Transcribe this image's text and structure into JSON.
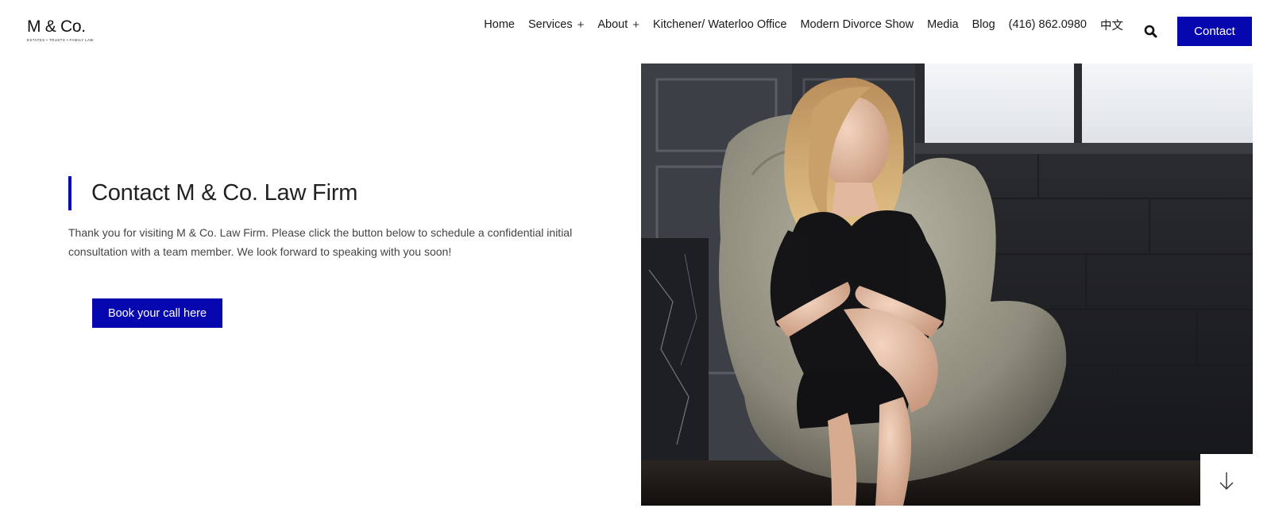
{
  "brand": {
    "logo_text": "M & Co.",
    "logo_tagline": "ESTATES • TRUSTS • FAMILY LAW"
  },
  "nav": {
    "items": [
      {
        "label": "Home",
        "has_submenu": false
      },
      {
        "label": "Services",
        "has_submenu": true
      },
      {
        "label": "About",
        "has_submenu": true
      },
      {
        "label": "Kitchener/ Waterloo Office",
        "has_submenu": false
      },
      {
        "label": "Modern Divorce Show",
        "has_submenu": false
      },
      {
        "label": "Media",
        "has_submenu": false
      },
      {
        "label": "Blog",
        "has_submenu": false
      },
      {
        "label": "(416) 862.0980",
        "has_submenu": false
      },
      {
        "label": "中文",
        "has_submenu": false
      }
    ],
    "submenu_glyph": "+",
    "search_icon": "search-icon",
    "contact_label": "Contact"
  },
  "hero": {
    "title": "Contact M & Co. Law Firm",
    "intro": "Thank you for visiting  M & Co. Law Firm. Please click the button below to schedule a confidential initial consultation with a team member. We look forward to speaking with you soon!",
    "cta_label": "Book your call here",
    "photo_icon": "portrait-photo",
    "scroll_icon": "arrow-down-icon"
  },
  "colors": {
    "accent": "#0707b0",
    "text": "#222222",
    "background": "#ffffff"
  }
}
